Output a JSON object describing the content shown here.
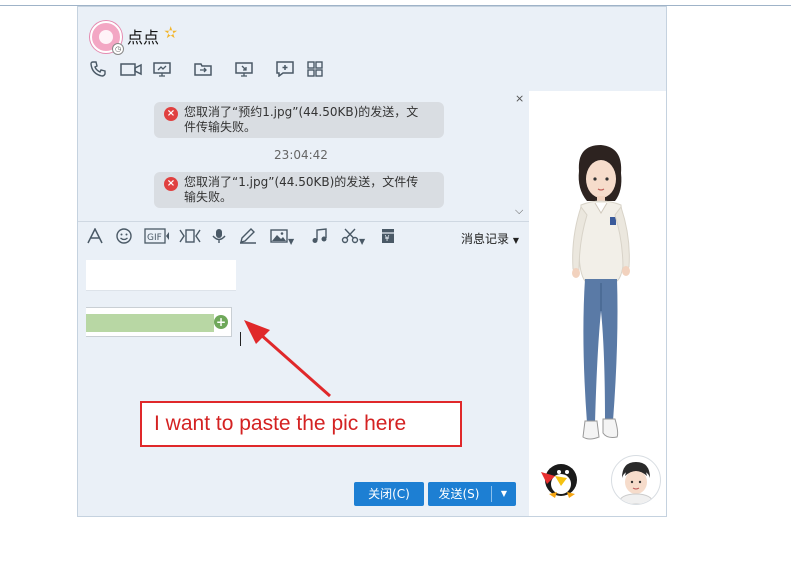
{
  "window": {
    "contact_name": "点点",
    "controls": [
      "▾",
      "—",
      "☐",
      "✕"
    ]
  },
  "toolbar_top": {
    "icons": [
      "phone-icon",
      "video-icon",
      "screen-share-icon",
      "file-transfer-icon",
      "remote-desktop-icon",
      "new-chat-icon",
      "apps-grid-icon"
    ]
  },
  "messages": [
    {
      "type": "error",
      "text": "您取消了“预约1.jpg”(44.50KB)的发送，文件传输失败。",
      "line1": "您取消了“预约1.jpg”(44.50KB)的发送，文",
      "line2": "件传输失败。"
    },
    {
      "type": "timestamp",
      "text": "23:04:42"
    },
    {
      "type": "error",
      "text": "您取消了“1.jpg”(44.50KB)的发送，文件传输失败。",
      "line1": "您取消了“1.jpg”(44.50KB)的发送，文件传",
      "line2": "输失败。"
    }
  ],
  "toolbar_input": {
    "icons": [
      "font-icon",
      "emoji-icon",
      "gif-icon",
      "video-clip-icon",
      "voice-icon",
      "draw-icon",
      "image-icon",
      "music-icon",
      "screenshot-icon",
      "red-packet-icon"
    ],
    "history_label": "消息记录"
  },
  "annotation": {
    "text": "I want to paste the pic here"
  },
  "buttons": {
    "close_label": "关闭(C)",
    "send_label": "发送(S)"
  },
  "colors": {
    "accent": "#1d7fd3",
    "annotation": "#e0282a",
    "error": "#e0403f"
  }
}
